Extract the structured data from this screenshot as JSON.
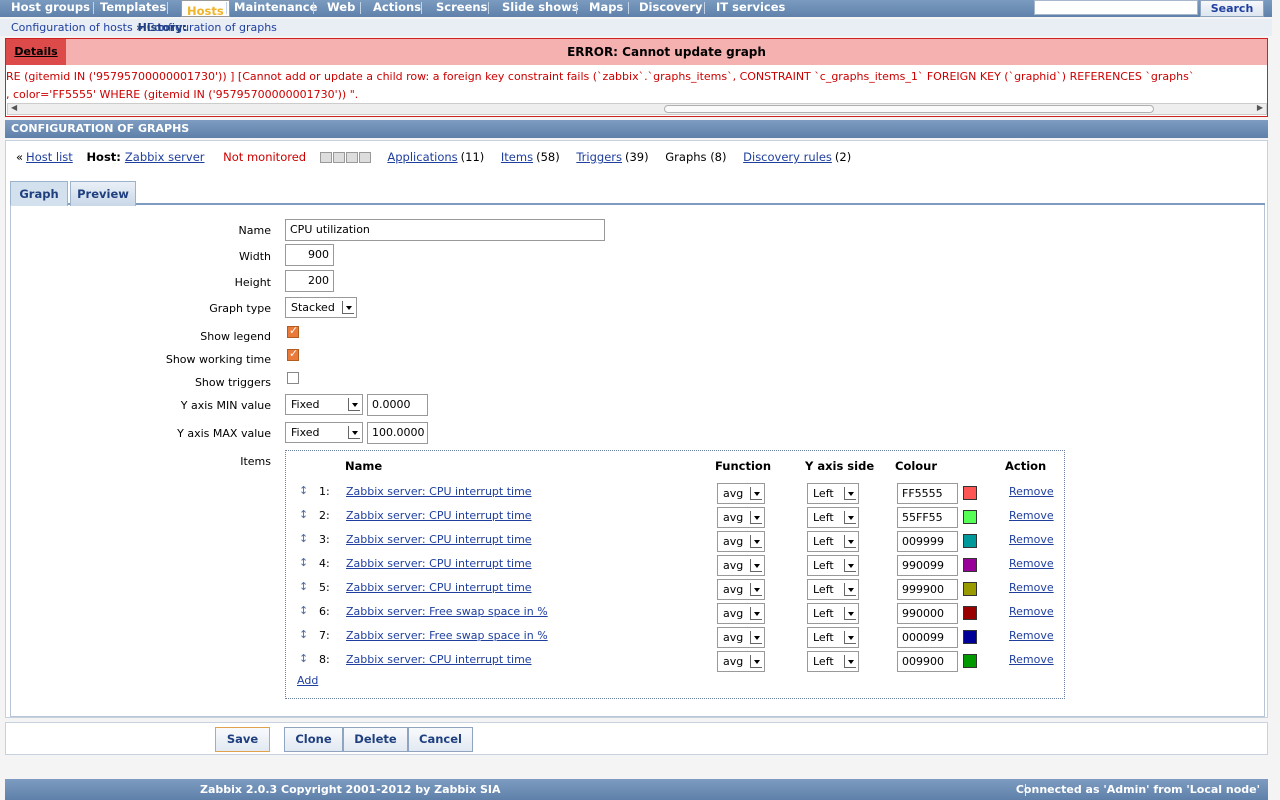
{
  "topmenu": {
    "items": [
      {
        "label": "Host groups",
        "selected": false
      },
      {
        "label": "Templates",
        "selected": false
      },
      {
        "label": "Hosts",
        "selected": true
      },
      {
        "label": "Maintenance",
        "selected": false
      },
      {
        "label": "Web",
        "selected": false
      },
      {
        "label": "Actions",
        "selected": false
      },
      {
        "label": "Screens",
        "selected": false
      },
      {
        "label": "Slide shows",
        "selected": false
      },
      {
        "label": "Maps",
        "selected": false
      },
      {
        "label": "Discovery",
        "selected": false
      },
      {
        "label": "IT services",
        "selected": false
      }
    ],
    "search_label": "Search"
  },
  "history": {
    "label": "History:",
    "crumbs": [
      "Configuration of hosts",
      "Configuration of graphs"
    ],
    "separator": "»"
  },
  "error": {
    "details_label": "Details",
    "title": "ERROR: Cannot update graph",
    "line1": "RE  (gitemid IN ('95795700000001730')) ] [Cannot add or update a child row: a foreign key constraint fails (`zabbix`.`graphs_items`, CONSTRAINT `c_graphs_items_1` FOREIGN KEY (`graphid`) REFERENCES `graphs`",
    "line2": ", color='FF5555' WHERE  (gitemid IN ('95795700000001730')) \"."
  },
  "section_title": "CONFIGURATION OF GRAPHS",
  "hostline": {
    "back_prefix": "«",
    "host_list": "Host list",
    "host_label": "Host:",
    "host_name": "Zabbix server",
    "status": "Not monitored",
    "applications_label": "Applications",
    "applications_count": "(11)",
    "items_label": "Items",
    "items_count": "(58)",
    "triggers_label": "Triggers",
    "triggers_count": "(39)",
    "graphs_text": "Graphs (8)",
    "discovery_label": "Discovery rules",
    "discovery_count": "(2)"
  },
  "tabs": [
    "Graph",
    "Preview"
  ],
  "form": {
    "name_label": "Name",
    "name_value": "CPU utilization",
    "width_label": "Width",
    "width_value": "900",
    "height_label": "Height",
    "height_value": "200",
    "graphtype_label": "Graph type",
    "graphtype_value": "Stacked",
    "legend_label": "Show legend",
    "legend_checked": true,
    "worktime_label": "Show working time",
    "worktime_checked": true,
    "triggers_label": "Show triggers",
    "triggers_checked": false,
    "ymin_label": "Y axis MIN value",
    "ymin_type": "Fixed",
    "ymin_value": "0.0000",
    "ymax_label": "Y axis MAX value",
    "ymax_type": "Fixed",
    "ymax_value": "100.0000",
    "items_label": "Items"
  },
  "items_table": {
    "headers": {
      "name": "Name",
      "function": "Function",
      "yaxis": "Y axis side",
      "colour": "Colour",
      "action": "Action"
    },
    "rows": [
      {
        "num": "1:",
        "name": "Zabbix server: CPU interrupt time",
        "function": "avg",
        "yaxis": "Left",
        "color": "FF5555",
        "swatch": "#FF5555",
        "action": "Remove"
      },
      {
        "num": "2:",
        "name": "Zabbix server: CPU interrupt time",
        "function": "avg",
        "yaxis": "Left",
        "color": "55FF55",
        "swatch": "#55FF55",
        "action": "Remove"
      },
      {
        "num": "3:",
        "name": "Zabbix server: CPU interrupt time",
        "function": "avg",
        "yaxis": "Left",
        "color": "009999",
        "swatch": "#009999",
        "action": "Remove"
      },
      {
        "num": "4:",
        "name": "Zabbix server: CPU interrupt time",
        "function": "avg",
        "yaxis": "Left",
        "color": "990099",
        "swatch": "#990099",
        "action": "Remove"
      },
      {
        "num": "5:",
        "name": "Zabbix server: CPU interrupt time",
        "function": "avg",
        "yaxis": "Left",
        "color": "999900",
        "swatch": "#999900",
        "action": "Remove"
      },
      {
        "num": "6:",
        "name": "Zabbix server: Free swap space in %",
        "function": "avg",
        "yaxis": "Left",
        "color": "990000",
        "swatch": "#990000",
        "action": "Remove"
      },
      {
        "num": "7:",
        "name": "Zabbix server: Free swap space in %",
        "function": "avg",
        "yaxis": "Left",
        "color": "000099",
        "swatch": "#000099",
        "action": "Remove"
      },
      {
        "num": "8:",
        "name": "Zabbix server: CPU interrupt time",
        "function": "avg",
        "yaxis": "Left",
        "color": "009900",
        "swatch": "#009900",
        "action": "Remove"
      }
    ],
    "add_label": "Add"
  },
  "buttons": {
    "save": "Save",
    "clone": "Clone",
    "delete": "Delete",
    "cancel": "Cancel"
  },
  "footer": {
    "copyright": "Zabbix 2.0.3 Copyright 2001-2012 by Zabbix SIA",
    "connected": "Connected as 'Admin' from 'Local node'"
  }
}
